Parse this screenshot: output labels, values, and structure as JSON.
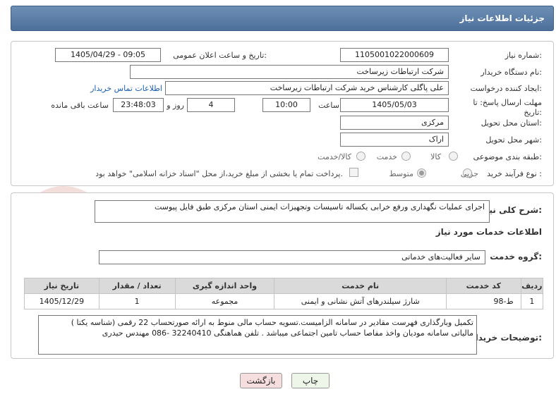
{
  "header": {
    "title": "جزئیات اطلاعات نیاز"
  },
  "fields": {
    "need_number_label": "شماره نیاز:",
    "need_number": "1105001022000609",
    "announce_label": "تاریخ و ساعت اعلان عمومی:",
    "announce_value": "1405/04/29 - 09:05",
    "buyer_org_label": "نام دستگاه خریدار:",
    "buyer_org": "شرکت ارتباطات زیرساخت",
    "creator_label": "ایجاد کننده درخواست:",
    "creator": "علی پاگلی کارشناس خرید شرکت ارتباطات زیرساخت",
    "contact_link": "اطلاعات تماس خریدار",
    "deadline_label": "مهلت ارسال پاسخ: تا تاریخ:",
    "deadline_date": "1405/05/03",
    "time_label": "ساعت",
    "deadline_time": "10:00",
    "days_value": "4",
    "days_label": "روز و",
    "remaining_time": "23:48:03",
    "remaining_label": "ساعت باقی مانده",
    "province_label": "استان محل تحویل:",
    "province": "مرکزی",
    "city_label": "شهر محل تحویل:",
    "city": "اراک",
    "category_label": "طبقه بندی موضوعی:",
    "category_options": [
      "کالا",
      "خدمت",
      "کالا/خدمت"
    ],
    "process_label": "نوع فرآیند خرید :",
    "process_options": [
      "جزیی",
      "متوسط"
    ],
    "payment_note": "پرداخت تمام یا بخشی از مبلغ خرید،از محل \"اسناد خزانه اسلامی\" خواهد بود."
  },
  "description": {
    "label": "شرح کلی نیاز:",
    "value": "اجرای عملیات نگهداری ورفع خرابی یکساله تاسیسات وتجهیزات ایمنی استان مرکزی طبق فایل پیوست"
  },
  "services": {
    "section_title": "اطلاعات خدمات مورد نیاز",
    "group_label": "گروه خدمت:",
    "group_value": "سایر فعالیت‌های خدماتی",
    "columns": [
      "ردیف",
      "کد خدمت",
      "نام خدمت",
      "واحد اندازه گیری",
      "تعداد / مقدار",
      "تاریخ نیاز"
    ],
    "rows": [
      [
        "1",
        "ط-98",
        "شارژ سیلندرهای آتش نشانی و ایمنی",
        "مجموعه",
        "1",
        "1405/12/29"
      ]
    ]
  },
  "buyer_notes": {
    "label": "توضیحات خریدار:",
    "line1": "تکمیل وبارگذاری فهرست مقادیر در سامانه الزامیست.تسویه حساب مالی منوط به ارائه صورتحساب 22 رقمی (شناسه یکتا )",
    "line2": "مالیاتی سامانه مودیان واخذ مفاصا حساب تامین اجتماعی میباشد . تلفن هماهنگی 32240410 -086 مهندس حیدری"
  },
  "buttons": {
    "print": "چاپ",
    "back": "بازگشت"
  },
  "colors": {
    "header": "#5a7ca6",
    "link": "#1a5fb4",
    "back_button": "#f6dede",
    "print_button": "#eef6ea"
  }
}
